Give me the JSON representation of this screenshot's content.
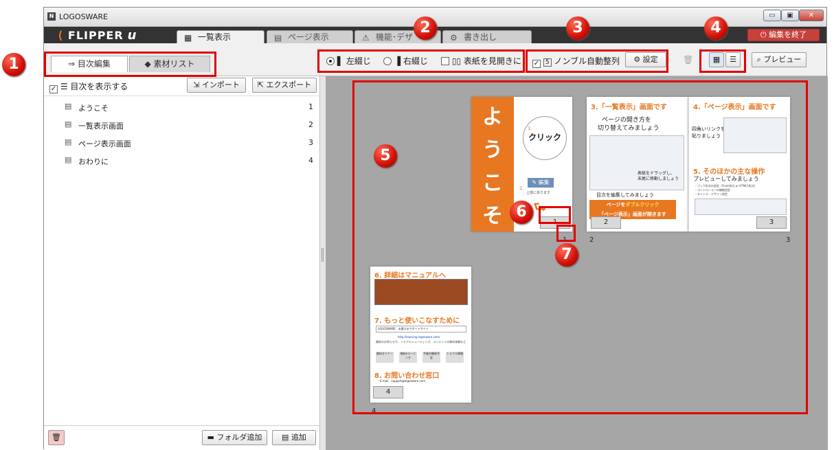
{
  "app": {
    "title": "LOGOSWARE",
    "brand": "FLIPPER",
    "brand_suffix": "u",
    "logo_letter": "N"
  },
  "window_buttons": {
    "minimize": "▭",
    "maximize": "▣",
    "close": "✕"
  },
  "main_tabs": [
    {
      "label": "一覧表示",
      "icon": "grid-icon"
    },
    {
      "label": "ページ表示",
      "icon": "page-icon"
    },
    {
      "label": "機能･デザ",
      "icon": "design-icon"
    },
    {
      "label": "書き出し",
      "icon": "export-gear-icon"
    }
  ],
  "end_edit_button": "編集を終了",
  "sub_tabs": [
    {
      "label": "目次編集"
    },
    {
      "label": "素材リスト"
    }
  ],
  "toolbar": {
    "left_binding": "左綴じ",
    "right_binding": "右綴じ",
    "cover_spread": "表紙を見開きに",
    "auto_numbering": "ノンブル自動整列",
    "auto_numbering_badge": "5",
    "settings": "設定",
    "preview": "プレビュー"
  },
  "toc": {
    "show_toc": "目次を表示する",
    "import": "インポート",
    "export": "エクスポート",
    "items": [
      {
        "label": "ようこそ",
        "num": "1"
      },
      {
        "label": "一覧表示画面",
        "num": "2"
      },
      {
        "label": "ページ表示画面",
        "num": "3"
      },
      {
        "label": "おわりに",
        "num": "4"
      }
    ],
    "add_folder": "フォルダ追加",
    "add": "追加"
  },
  "pages": {
    "p1": {
      "big": "ようこそ",
      "click": "クリック",
      "step1": "1.",
      "step2": "2.",
      "edit": "編集",
      "edit_hint": "上部にあります",
      "badge": "1",
      "num": "1"
    },
    "p2": {
      "title": "3.「一覧表示」画面です",
      "sub1": "ページの開き方を",
      "sub2": "切り替えてみましょう",
      "drag": "表紙をドラッグし、",
      "drag2": "末尾に移動しましょう",
      "toc": "目次を編集してみましょう",
      "dbl1a": "ページを",
      "dbl1b": "ダブルクリック",
      "dbl2": "「ページ表示」画面が開きます",
      "badge": "2",
      "num": "2"
    },
    "p3": {
      "title": "4.「ページ表示」画面です",
      "sub1": "四角いリンクを",
      "sub2": "貼りましょう",
      "other": "5. そのほかの主な操作",
      "prev": "プレビューしてみましょう",
      "li1": "・ブック形式の設定（Flash形式 or HTML5形式）",
      "li2": "・コントローラーの機能設定",
      "li3": "・タイトル・デザイン設定",
      "badge": "3",
      "num": "3"
    },
    "p4": {
      "t6": "6. 詳細はマニュアルへ",
      "t7": "7. もっと使いこなすために",
      "search": "LOGOSWARE　お客さまサポートサイト",
      "url": "http://learning.logosware.com/",
      "desc": "最新のお知らせや、トラブルシューティング、コンテンツの無料体験など",
      "b1": "無料セミナー",
      "b2": "無料eラーニング",
      "b3": "今後の開発予定",
      "b4": "トラブル情報",
      "t8": "8. お問い合わせ窓口",
      "mail": "・E-mail　support@logosware.com",
      "badge": "4",
      "num": "4"
    }
  },
  "callouts": [
    "1",
    "2",
    "3",
    "4",
    "5",
    "6",
    "7"
  ]
}
